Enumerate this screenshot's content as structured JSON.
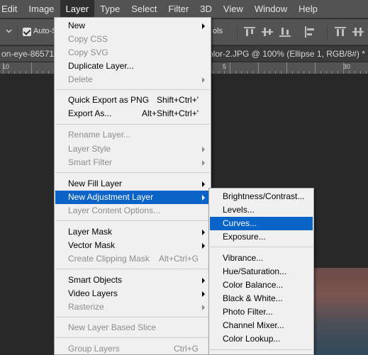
{
  "menubar": {
    "items": [
      "Edit",
      "Image",
      "Layer",
      "Type",
      "Select",
      "Filter",
      "3D",
      "View",
      "Window",
      "Help"
    ],
    "active": "Layer"
  },
  "options_bar": {
    "auto_select_label": "Auto-S",
    "partial_label": "ols",
    "icons": [
      "chevron-icon",
      "checkbox-icon",
      "align-top-icon",
      "align-vcenter-icon",
      "align-bottom-icon",
      "align-left-icon",
      "align-hcenter-icon",
      "align-right-icon",
      "distribute-top-icon",
      "distribute-vcenter-icon"
    ]
  },
  "tabs": {
    "left": "on-eye-865711.j",
    "right": "olor-2.JPG @ 100% (Ellipse 1, RGB/8#) *"
  },
  "ruler": {
    "labels": [
      "10",
      "5",
      "30"
    ]
  },
  "layer_menu": {
    "items": [
      {
        "label": "New",
        "shortcut": "",
        "submenu": true,
        "disabled": false
      },
      {
        "label": "Copy CSS",
        "shortcut": "",
        "submenu": false,
        "disabled": true
      },
      {
        "label": "Copy SVG",
        "shortcut": "",
        "submenu": false,
        "disabled": true
      },
      {
        "label": "Duplicate Layer...",
        "shortcut": "",
        "submenu": false,
        "disabled": false
      },
      {
        "label": "Delete",
        "shortcut": "",
        "submenu": true,
        "disabled": true
      },
      {
        "label": "Quick Export as PNG",
        "shortcut": "Shift+Ctrl+'",
        "submenu": false,
        "disabled": false
      },
      {
        "label": "Export As...",
        "shortcut": "Alt+Shift+Ctrl+'",
        "submenu": false,
        "disabled": false
      },
      {
        "label": "Rename Layer...",
        "shortcut": "",
        "submenu": false,
        "disabled": true
      },
      {
        "label": "Layer Style",
        "shortcut": "",
        "submenu": true,
        "disabled": true
      },
      {
        "label": "Smart Filter",
        "shortcut": "",
        "submenu": true,
        "disabled": true
      },
      {
        "label": "New Fill Layer",
        "shortcut": "",
        "submenu": true,
        "disabled": false
      },
      {
        "label": "New Adjustment Layer",
        "shortcut": "",
        "submenu": true,
        "disabled": false,
        "highlighted": true
      },
      {
        "label": "Layer Content Options...",
        "shortcut": "",
        "submenu": false,
        "disabled": true
      },
      {
        "label": "Layer Mask",
        "shortcut": "",
        "submenu": true,
        "disabled": false
      },
      {
        "label": "Vector Mask",
        "shortcut": "",
        "submenu": true,
        "disabled": false
      },
      {
        "label": "Create Clipping Mask",
        "shortcut": "Alt+Ctrl+G",
        "submenu": false,
        "disabled": true
      },
      {
        "label": "Smart Objects",
        "shortcut": "",
        "submenu": true,
        "disabled": false
      },
      {
        "label": "Video Layers",
        "shortcut": "",
        "submenu": true,
        "disabled": false
      },
      {
        "label": "Rasterize",
        "shortcut": "",
        "submenu": true,
        "disabled": true
      },
      {
        "label": "New Layer Based Slice",
        "shortcut": "",
        "submenu": false,
        "disabled": true
      },
      {
        "label": "Group Layers",
        "shortcut": "Ctrl+G",
        "submenu": false,
        "disabled": true
      }
    ]
  },
  "adjustment_menu": {
    "items": [
      {
        "label": "Brightness/Contrast..."
      },
      {
        "label": "Levels..."
      },
      {
        "label": "Curves...",
        "highlighted": true
      },
      {
        "label": "Exposure..."
      },
      {
        "label": "Vibrance..."
      },
      {
        "label": "Hue/Saturation..."
      },
      {
        "label": "Color Balance..."
      },
      {
        "label": "Black & White..."
      },
      {
        "label": "Photo Filter..."
      },
      {
        "label": "Channel Mixer..."
      },
      {
        "label": "Color Lookup..."
      }
    ]
  },
  "colors": {
    "menu_bg": "#f0f0f0",
    "highlight": "#0a64c8",
    "chrome": "#535353",
    "canvas": "#282828"
  }
}
